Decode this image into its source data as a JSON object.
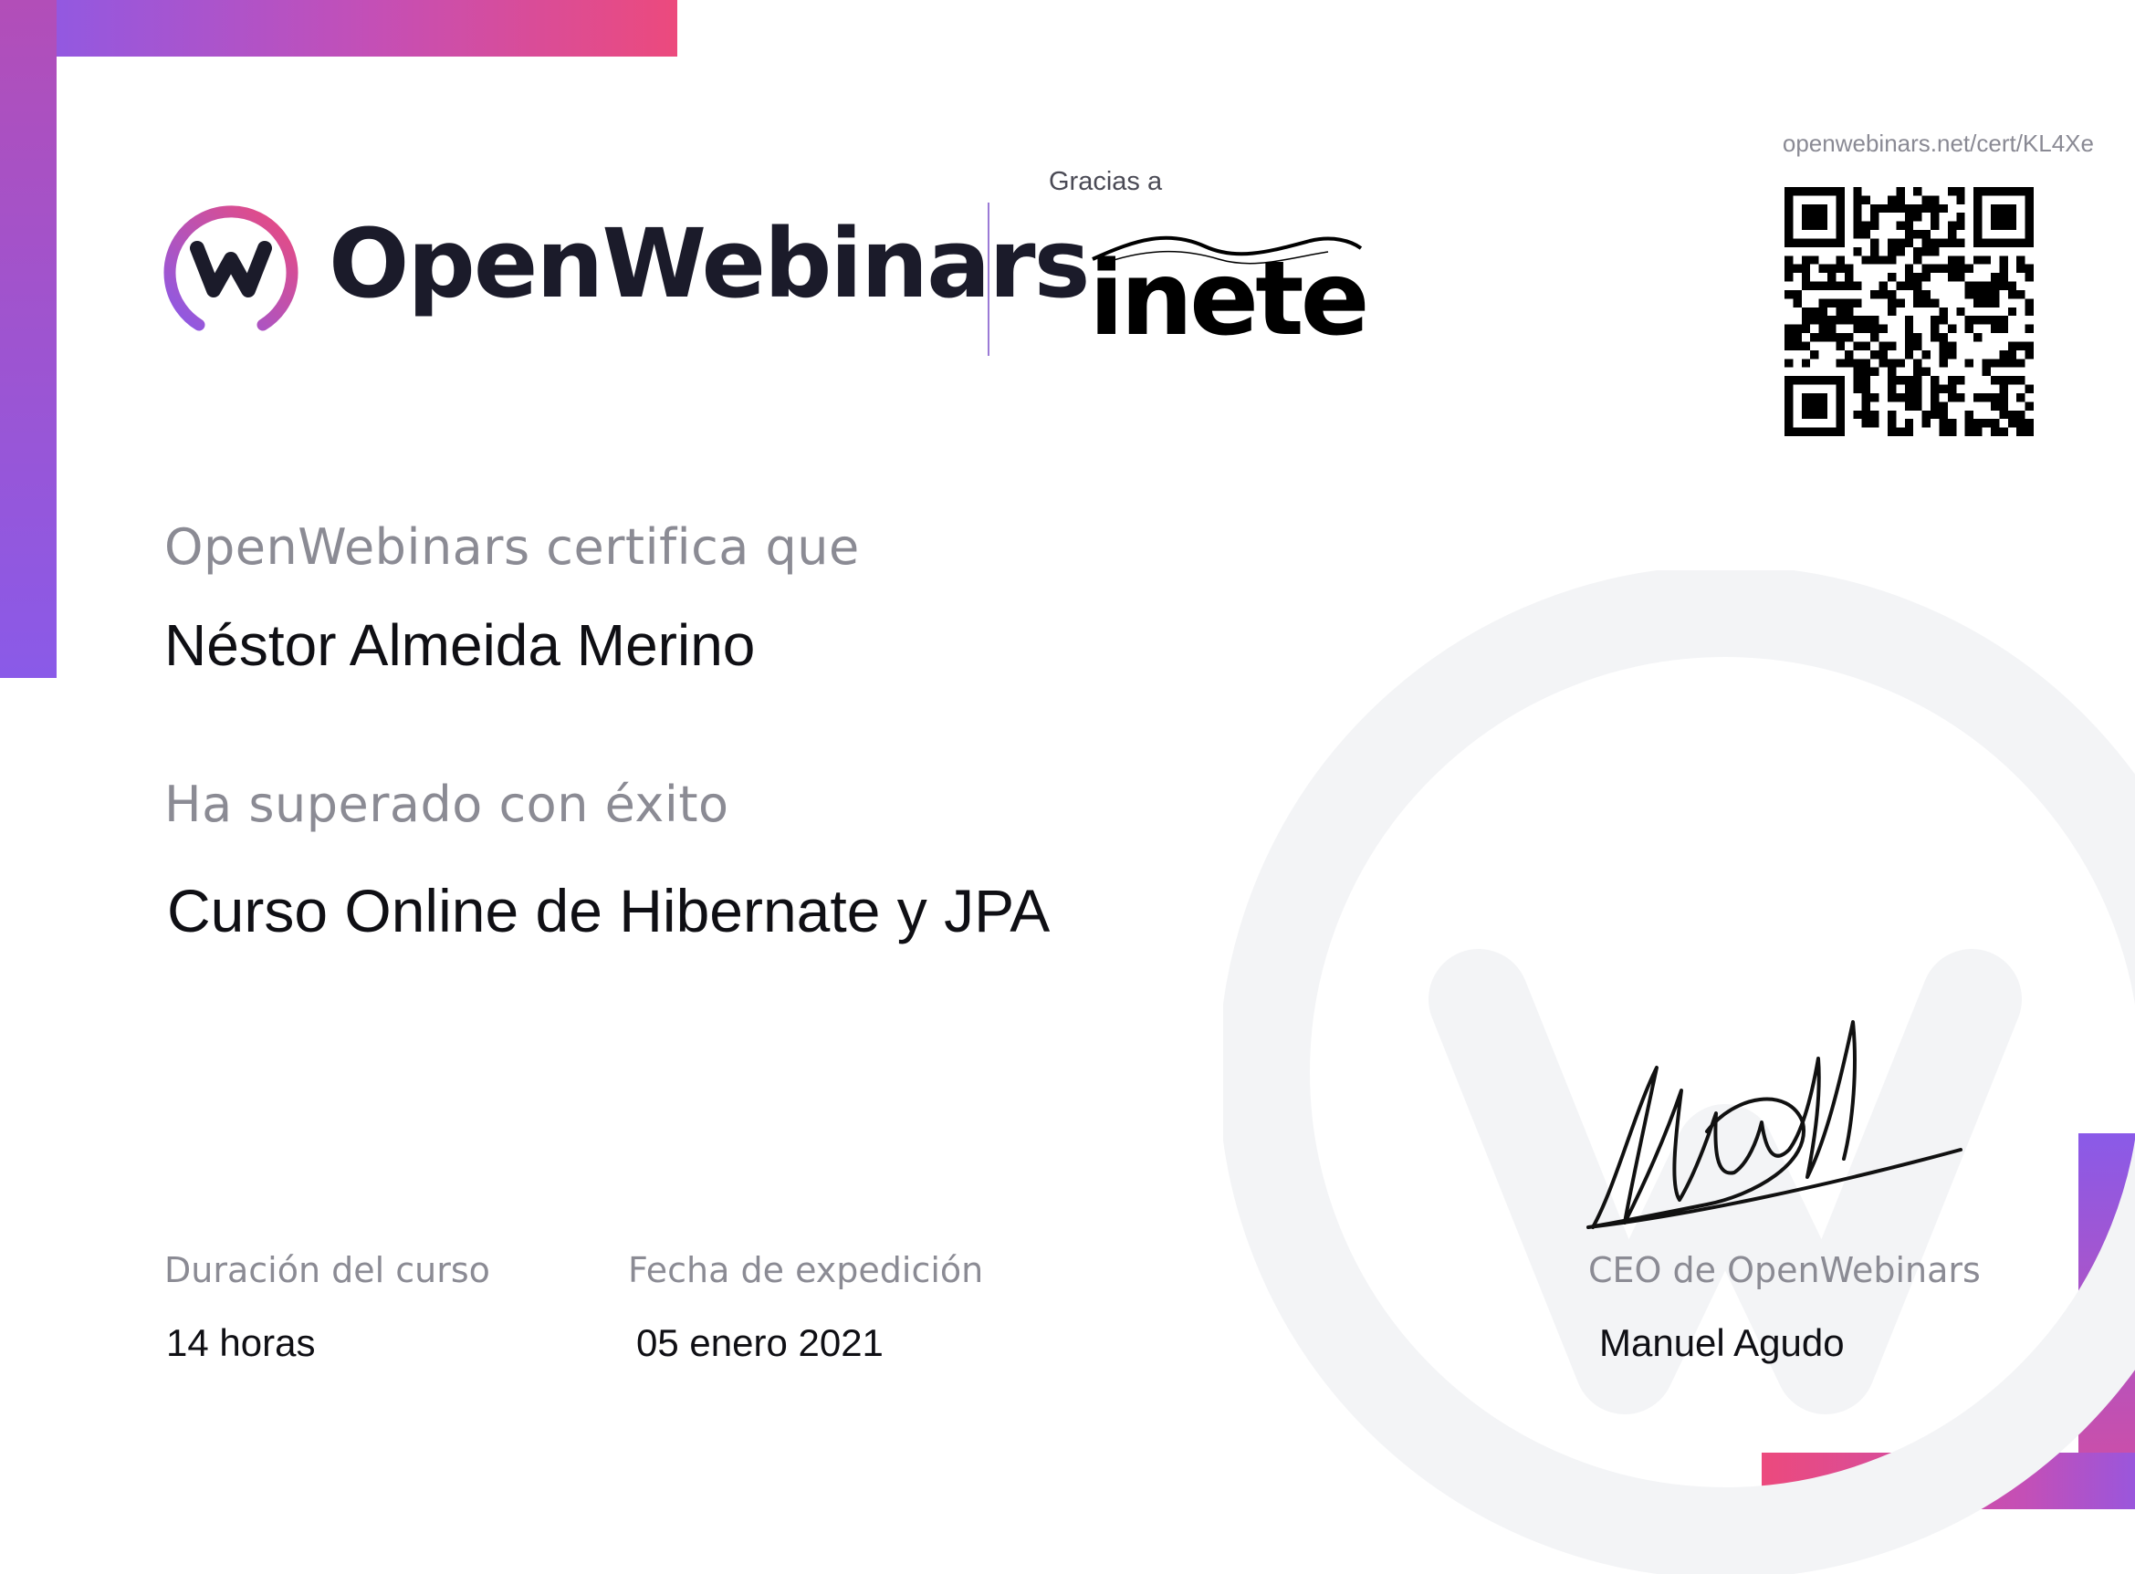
{
  "header": {
    "brand_name": "OpenWebinars",
    "sponsor_intro": "Gracias a",
    "sponsor_name": "inetel",
    "cert_url": "openwebinars.net/cert/KL4Xe"
  },
  "certificate": {
    "certifies_label": "OpenWebinars certifica que",
    "recipient_name": "Néstor Almeida Merino",
    "passed_label": "Ha superado con éxito",
    "course_name": "Curso Online de Hibernate y JPA"
  },
  "footer": {
    "duration_label": "Duración del curso",
    "duration_value": "14 horas",
    "issue_date_label": "Fecha de expedición",
    "issue_date_value": "05 enero 2021",
    "signer_role": "CEO de OpenWebinars",
    "signer_name": "Manuel Agudo"
  },
  "icons": [
    "openwebinars-logo-icon",
    "inetel-logo-icon",
    "qr-code-icon",
    "signature-icon",
    "watermark-logo-icon"
  ],
  "colors": {
    "gradient_purple": "#8a5ae8",
    "gradient_pink": "#ec4a7d",
    "text_dark": "#0f0f14",
    "text_muted": "#8b8b94"
  }
}
